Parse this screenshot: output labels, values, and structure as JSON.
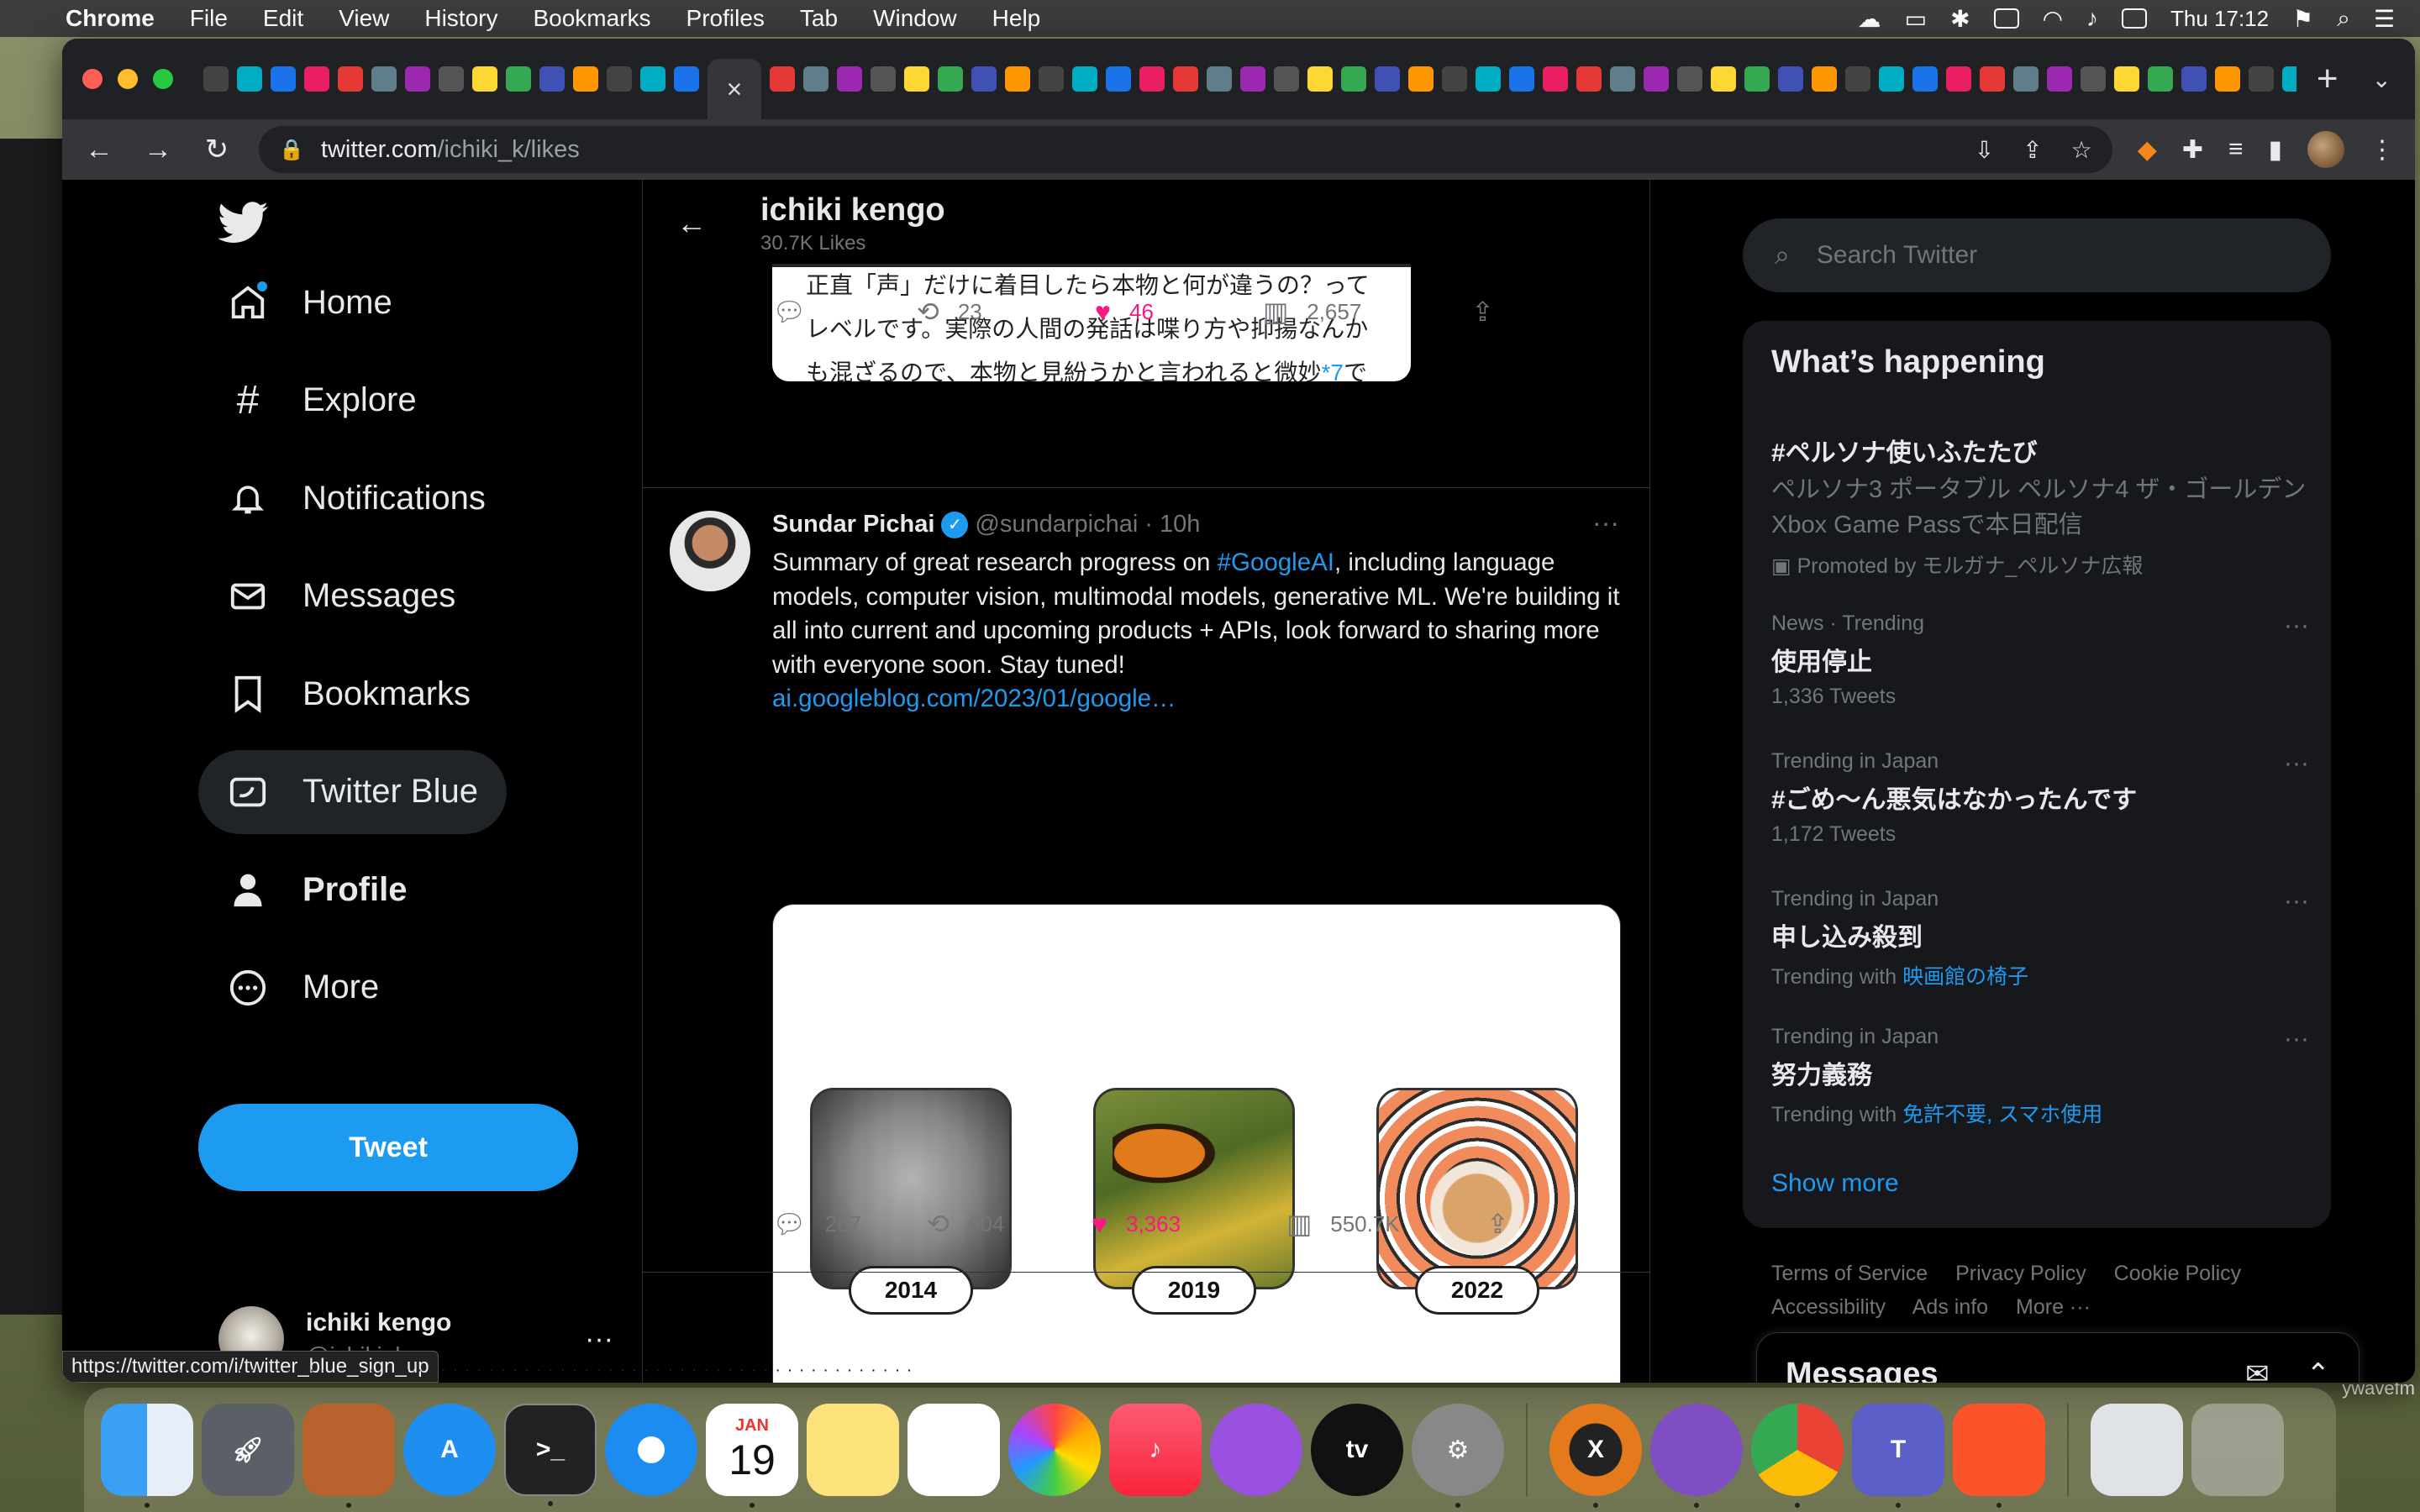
{
  "menubar": {
    "app_name": "Chrome",
    "items": [
      "File",
      "Edit",
      "View",
      "History",
      "Bookmarks",
      "Profiles",
      "Tab",
      "Window",
      "Help"
    ],
    "clock": "Thu 17:12"
  },
  "browser": {
    "url_host": "twitter.com",
    "url_path": "/ichiki_k/likes",
    "status_url": "https://twitter.com/i/twitter_blue_sign_up"
  },
  "sidebar": {
    "items": [
      {
        "label": "Home",
        "icon": "home-icon"
      },
      {
        "label": "Explore",
        "icon": "hashtag-icon"
      },
      {
        "label": "Notifications",
        "icon": "bell-icon"
      },
      {
        "label": "Messages",
        "icon": "envelope-icon"
      },
      {
        "label": "Bookmarks",
        "icon": "bookmark-icon"
      },
      {
        "label": "Twitter Blue",
        "icon": "twitter-blue-icon"
      },
      {
        "label": "Profile",
        "icon": "person-icon"
      },
      {
        "label": "More",
        "icon": "more-circle-icon"
      }
    ],
    "tweet_button": "Tweet",
    "account": {
      "name": "ichiki kengo",
      "handle": "@ichiki_k"
    }
  },
  "header": {
    "title": "ichiki kengo",
    "subtitle": "30.7K Likes"
  },
  "quoted": {
    "line1": "正直「声」だけに着目したら本物と何が違うの？って",
    "line2": "レベルです。実際の人間の発話は喋り方や抑揚なんか",
    "line3_start": "も混ざるので、本物と見紛うかと言われると微妙",
    "line3_link": "*7",
    "line3_end": "で"
  },
  "prev_tweet_actions": {
    "replies": "",
    "retweets": "23",
    "likes": "46",
    "views": "2,657"
  },
  "tweet": {
    "author": "Sundar Pichai",
    "handle": "@sundarpichai",
    "time": "· 10h",
    "text_before": "Summary of great research progress on ",
    "hashtag": "#GoogleAI",
    "text_after": ", including language models, computer vision, multimodal models, generative ML. We're building it all into current and upcoming products + APIs, look forward to sharing more with everyone soon. Stay tuned!",
    "link": "ai.googleblog.com/2023/01/google…",
    "years": [
      "2014",
      "2019",
      "2022"
    ],
    "actions": {
      "replies": "267",
      "retweets": "604",
      "likes": "3,363",
      "views": "550.7K"
    }
  },
  "right": {
    "search_placeholder": "Search Twitter",
    "happening_title": "What’s happening",
    "promo": {
      "name": "#ペルソナ使いふたたび",
      "desc": "ペルソナ3 ポータブル ペルソナ4 ザ・ゴールデン Xbox Game Passで本日配信",
      "promoted": "Promoted by モルガナ_ペルソナ広報"
    },
    "trends": [
      {
        "meta": "News · Trending",
        "name": "使用停止",
        "count": "1,336 Tweets"
      },
      {
        "meta": "Trending in Japan",
        "name": "#ごめ〜ん悪気はなかったんです",
        "count": "1,172 Tweets"
      },
      {
        "meta": "Trending in Japan",
        "name": "申し込み殺到",
        "with_label": "Trending with",
        "with": "映画館の椅子"
      },
      {
        "meta": "Trending in Japan",
        "name": "努力義務",
        "with_label": "Trending with",
        "with": "免許不要, スマホ使用"
      }
    ],
    "show_more": "Show more",
    "footer": [
      "Terms of Service",
      "Privacy Policy",
      "Cookie Policy",
      "Accessibility",
      "Ads info",
      "More ···"
    ],
    "messages_title": "Messages"
  },
  "dock": {
    "calendar_month": "JAN",
    "calendar_day": "19",
    "tv_label": "tv"
  },
  "colors": {
    "accent": "#1d9bf0",
    "like": "#f91880",
    "bg": "#000000"
  }
}
